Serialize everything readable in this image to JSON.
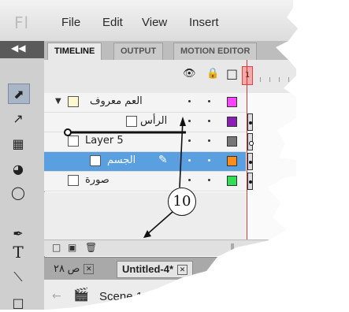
{
  "app": {
    "logo": "Fl"
  },
  "menu": [
    "File",
    "Edit",
    "View",
    "Insert"
  ],
  "panel_tabs": [
    "TIMELINE",
    "OUTPUT",
    "MOTION EDITOR"
  ],
  "frame_number": "1",
  "layers": [
    {
      "name": "العم معروف",
      "kind": "folder",
      "color": "#ff44ff",
      "selected": false
    },
    {
      "name": "الرأس",
      "kind": "layer",
      "color": "#8a1fb5",
      "selected": false
    },
    {
      "name": "Layer 5",
      "kind": "layer",
      "color": "#777777",
      "selected": false
    },
    {
      "name": "الجسم",
      "kind": "layer",
      "color": "#ff8c1a",
      "selected": true
    },
    {
      "name": "صورة",
      "kind": "layer",
      "color": "#33dd55",
      "selected": false
    }
  ],
  "doc_tabs": [
    {
      "label": "ص ٢٨",
      "active": false
    },
    {
      "label": "Untitled-4*",
      "active": true
    }
  ],
  "scene_label": "Scene 1",
  "callout_number": "10",
  "colors": {
    "selected_row": "#5a9fe0",
    "playhead": "#dd3333"
  }
}
